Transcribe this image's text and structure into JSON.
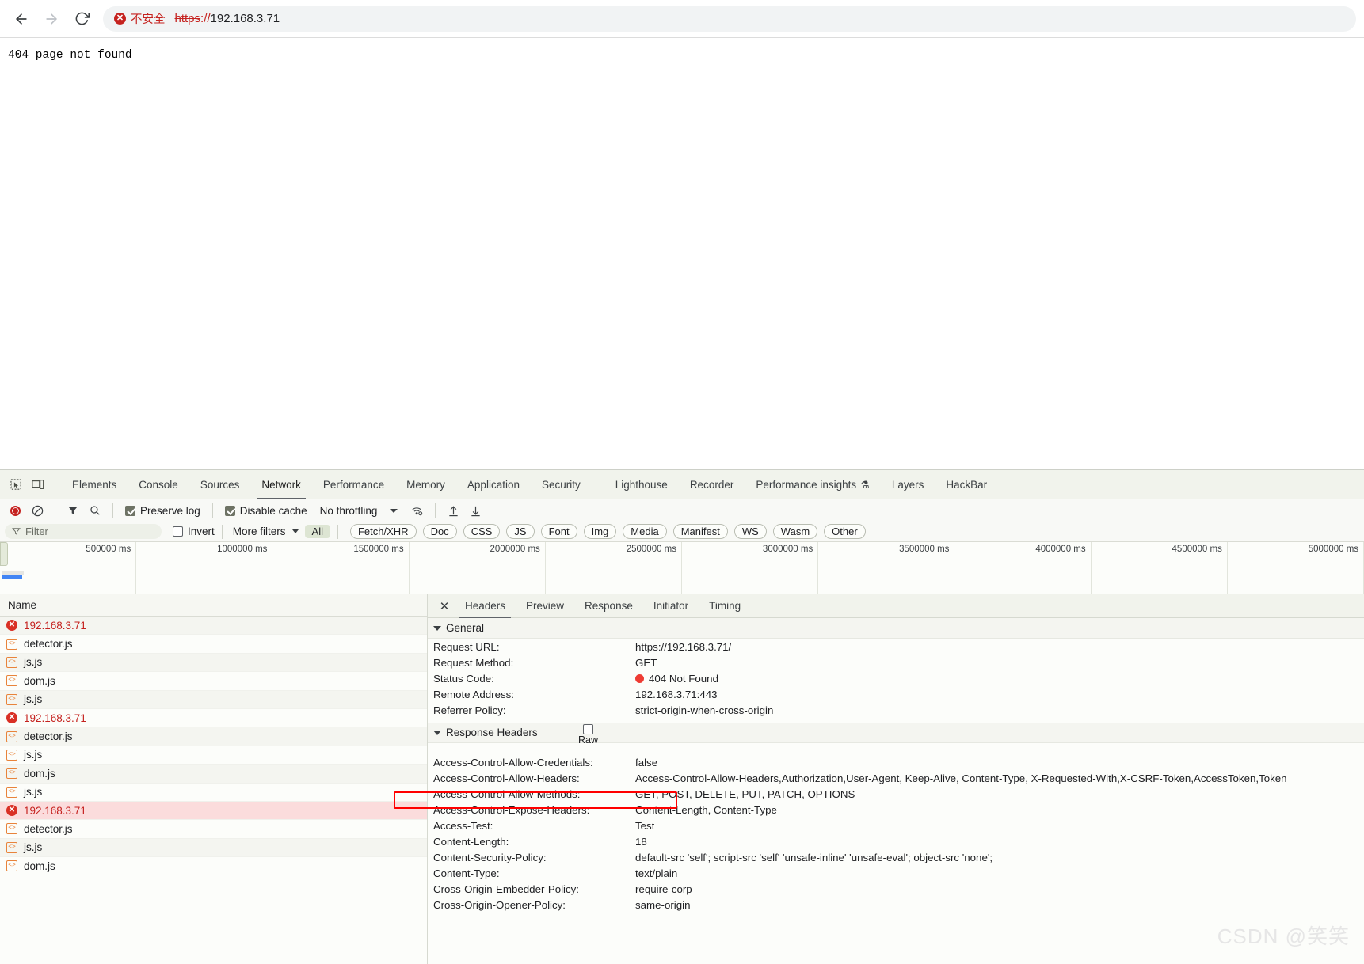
{
  "browser": {
    "back_icon": "back-arrow-icon",
    "forward_icon": "forward-arrow-icon",
    "reload_icon": "reload-icon",
    "security_chip_label": "不安全",
    "url_scheme": "https",
    "url_separator": "://",
    "url_host": "192.168.3.71",
    "url_full": "https://192.168.3.71"
  },
  "page": {
    "body_text": "404 page not found"
  },
  "devtools": {
    "tabs": [
      {
        "label": "Elements",
        "active": false
      },
      {
        "label": "Console",
        "active": false
      },
      {
        "label": "Sources",
        "active": false
      },
      {
        "label": "Network",
        "active": true
      },
      {
        "label": "Performance",
        "active": false
      },
      {
        "label": "Memory",
        "active": false
      },
      {
        "label": "Application",
        "active": false
      },
      {
        "label": "Security",
        "active": false
      }
    ],
    "tabs_right": [
      {
        "label": "Lighthouse",
        "flask": ""
      },
      {
        "label": "Recorder",
        "flask": ""
      },
      {
        "label": "Performance insights",
        "flask": "⚗"
      },
      {
        "label": "Layers",
        "flask": ""
      },
      {
        "label": "HackBar",
        "flask": ""
      }
    ],
    "controls": {
      "record_title": "record-button",
      "clear_title": "clear-button",
      "filter_title": "filter-toggle",
      "search_title": "search-button",
      "preserve_log_label": "Preserve log",
      "preserve_log_checked": true,
      "disable_cache_label": "Disable cache",
      "disable_cache_checked": true,
      "throttling_label": "No throttling",
      "wifi_title": "network-conditions",
      "import_title": "import-har",
      "export_title": "export-har"
    },
    "filters": {
      "filter_placeholder": "Filter",
      "invert_label": "Invert",
      "invert_checked": false,
      "more_filters_label": "More filters",
      "all_label": "All",
      "types": [
        "Fetch/XHR",
        "Doc",
        "CSS",
        "JS",
        "Font",
        "Img",
        "Media",
        "Manifest",
        "WS",
        "Wasm",
        "Other"
      ]
    },
    "overview": {
      "ticks": [
        "500000 ms",
        "1000000 ms",
        "1500000 ms",
        "2000000 ms",
        "2500000 ms",
        "3000000 ms",
        "3500000 ms",
        "4000000 ms",
        "4500000 ms",
        "5000000 ms",
        ""
      ]
    },
    "request_list": {
      "column_header": "Name",
      "rows": [
        {
          "name": "192.168.3.71",
          "type": "error",
          "selected": false
        },
        {
          "name": "detector.js",
          "type": "js",
          "selected": false
        },
        {
          "name": "js.js",
          "type": "js",
          "selected": false
        },
        {
          "name": "dom.js",
          "type": "js",
          "selected": false
        },
        {
          "name": "js.js",
          "type": "js",
          "selected": false
        },
        {
          "name": "192.168.3.71",
          "type": "error",
          "selected": false
        },
        {
          "name": "detector.js",
          "type": "js",
          "selected": false
        },
        {
          "name": "js.js",
          "type": "js",
          "selected": false
        },
        {
          "name": "dom.js",
          "type": "js",
          "selected": false
        },
        {
          "name": "js.js",
          "type": "js",
          "selected": false
        },
        {
          "name": "192.168.3.71",
          "type": "error",
          "selected": true
        },
        {
          "name": "detector.js",
          "type": "js",
          "selected": false
        },
        {
          "name": "js.js",
          "type": "js",
          "selected": false
        },
        {
          "name": "dom.js",
          "type": "js",
          "selected": false
        }
      ]
    },
    "detail": {
      "close_icon": "close-icon",
      "tabs": [
        {
          "label": "Headers",
          "active": true
        },
        {
          "label": "Preview",
          "active": false
        },
        {
          "label": "Response",
          "active": false
        },
        {
          "label": "Initiator",
          "active": false
        },
        {
          "label": "Timing",
          "active": false
        }
      ],
      "general_section_label": "General",
      "general": [
        {
          "key": "Request URL:",
          "value": "https://192.168.3.71/",
          "status": false
        },
        {
          "key": "Request Method:",
          "value": "GET",
          "status": false
        },
        {
          "key": "Status Code:",
          "value": "404 Not Found",
          "status": true
        },
        {
          "key": "Remote Address:",
          "value": "192.168.3.71:443",
          "status": false
        },
        {
          "key": "Referrer Policy:",
          "value": "strict-origin-when-cross-origin",
          "status": false
        }
      ],
      "response_section_label": "Response Headers",
      "raw_label": "Raw",
      "raw_checked": false,
      "response_headers": [
        {
          "key": "Access-Control-Allow-Credentials:",
          "value": "false",
          "highlight": false
        },
        {
          "key": "Access-Control-Allow-Headers:",
          "value": "Access-Control-Allow-Headers,Authorization,User-Agent, Keep-Alive, Content-Type, X-Requested-With,X-CSRF-Token,AccessToken,Token",
          "highlight": false
        },
        {
          "key": "Access-Control-Allow-Methods:",
          "value": "GET, POST, DELETE, PUT, PATCH, OPTIONS",
          "highlight": false
        },
        {
          "key": "Access-Control-Expose-Headers:",
          "value": "Content-Length, Content-Type",
          "highlight": false
        },
        {
          "key": "Access-Test:",
          "value": "Test",
          "highlight": true
        },
        {
          "key": "Content-Length:",
          "value": "18",
          "highlight": false
        },
        {
          "key": "Content-Security-Policy:",
          "value": "default-src 'self'; script-src 'self' 'unsafe-inline' 'unsafe-eval'; object-src 'none';",
          "highlight": false
        },
        {
          "key": "Content-Type:",
          "value": "text/plain",
          "highlight": false
        },
        {
          "key": "Cross-Origin-Embedder-Policy:",
          "value": "require-corp",
          "highlight": false
        },
        {
          "key": "Cross-Origin-Opener-Policy:",
          "value": "same-origin",
          "highlight": false
        }
      ]
    }
  },
  "watermark": "CSDN @笑笑",
  "colors": {
    "error_red": "#c5221f",
    "highlight_red": "#ff0000",
    "selected_row": "#fbdcdc",
    "accent_tab": "#5f6368"
  }
}
